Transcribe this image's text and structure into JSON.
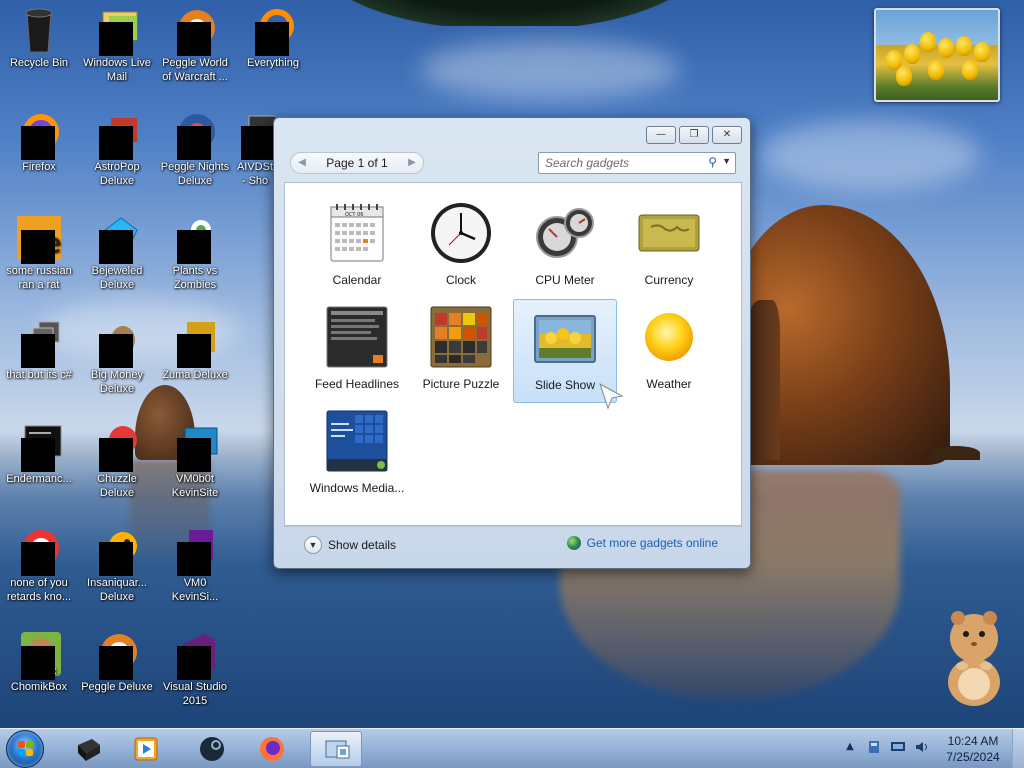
{
  "desktop_icons": [
    {
      "label": "Recycle Bin"
    },
    {
      "label": "Windows Live\nMail"
    },
    {
      "label": "Peggle World\nof Warcraft ..."
    },
    {
      "label": "Everything"
    },
    {
      "label": "Firefox"
    },
    {
      "label": "AstroPop\nDeluxe"
    },
    {
      "label": "Peggle Nights\nDeluxe"
    },
    {
      "label": "AIVDSt\n- Sho"
    },
    {
      "label": "some russian\nran a rat"
    },
    {
      "label": "Bejeweled\nDeluxe"
    },
    {
      "label": "Plants vs\nZombies"
    },
    {
      "label": "that but its c#"
    },
    {
      "label": "Big Money\nDeluxe"
    },
    {
      "label": "Zuma Deluxe"
    },
    {
      "label": "Endermanc..."
    },
    {
      "label": "Chuzzle\nDeluxe"
    },
    {
      "label": "VM0b0t\nKevinSite"
    },
    {
      "label": "none of you\nretards kno..."
    },
    {
      "label": "Insaniquar...\nDeluxe"
    },
    {
      "label": "VM0\nKevinSi..."
    },
    {
      "label": "ChomikBox"
    },
    {
      "label": "Peggle Deluxe"
    },
    {
      "label": "Visual Studio\n2015"
    }
  ],
  "gallery": {
    "page_label": "Page 1 of 1",
    "search_placeholder": "Search gadgets",
    "window_buttons": {
      "minimize": "—",
      "restore": "❐",
      "close": "✕"
    },
    "gadgets": [
      {
        "label": "Calendar"
      },
      {
        "label": "Clock"
      },
      {
        "label": "CPU Meter"
      },
      {
        "label": "Currency"
      },
      {
        "label": "Feed Headlines"
      },
      {
        "label": "Picture Puzzle"
      },
      {
        "label": "Slide Show",
        "selected": true
      },
      {
        "label": "Weather"
      },
      {
        "label": "Windows Media..."
      }
    ],
    "calendar_month": "OCT 06",
    "show_details": "Show details",
    "get_more": "Get more gadgets online"
  },
  "taskbar": {
    "time": "10:24 AM",
    "date": "7/25/2024"
  },
  "colors": {
    "accent": "#1f5fb0",
    "selection": "#c7e0f8"
  }
}
